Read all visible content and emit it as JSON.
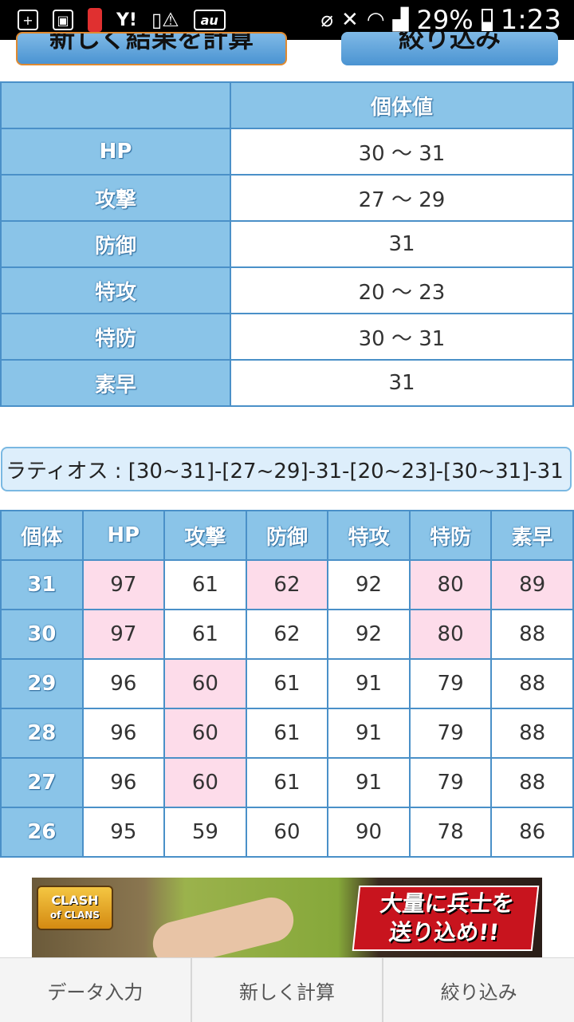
{
  "status_bar": {
    "battery": "29%",
    "time": "1:23",
    "icons": [
      "plus-icon",
      "photo-icon",
      "phone-battery-icon",
      "yahoo-icon",
      "sim-alert-icon",
      "au-icon",
      "nfc-icon",
      "mute-icon",
      "wifi-icon",
      "signal-icon",
      "battery-icon"
    ]
  },
  "top_buttons": {
    "left": "新しく結果を計算",
    "right": "絞り込み"
  },
  "iv_table": {
    "header": "個体値",
    "rows": [
      {
        "stat": "HP",
        "value": "30 ～ 31"
      },
      {
        "stat": "攻撃",
        "value": "27 ～ 29"
      },
      {
        "stat": "防御",
        "value": "31"
      },
      {
        "stat": "特攻",
        "value": "20 ～ 23"
      },
      {
        "stat": "特防",
        "value": "30 ～ 31"
      },
      {
        "stat": "素早",
        "value": "31"
      }
    ]
  },
  "summary": "ラティオス : [30~31]-[27~29]-31-[20~23]-[30~31]-31",
  "stat_table": {
    "headers": [
      "個体",
      "HP",
      "攻撃",
      "防御",
      "特攻",
      "特防",
      "素早"
    ],
    "rows": [
      {
        "iv": "31",
        "values": [
          "97",
          "61",
          "62",
          "92",
          "80",
          "89"
        ]
      },
      {
        "iv": "30",
        "values": [
          "97",
          "61",
          "62",
          "92",
          "80",
          "88"
        ]
      },
      {
        "iv": "29",
        "values": [
          "96",
          "60",
          "61",
          "91",
          "79",
          "88"
        ]
      },
      {
        "iv": "28",
        "values": [
          "96",
          "60",
          "61",
          "91",
          "79",
          "88"
        ]
      },
      {
        "iv": "27",
        "values": [
          "96",
          "60",
          "61",
          "91",
          "79",
          "88"
        ]
      },
      {
        "iv": "26",
        "values": [
          "95",
          "59",
          "60",
          "90",
          "78",
          "86"
        ]
      }
    ]
  },
  "ad": {
    "logo_line1": "CLASH",
    "logo_line2": "of CLANS",
    "text_line1": "大量に兵士を",
    "text_line2": "送り込め!!"
  },
  "bottom_nav": [
    "データ入力",
    "新しく計算",
    "絞り込み"
  ]
}
